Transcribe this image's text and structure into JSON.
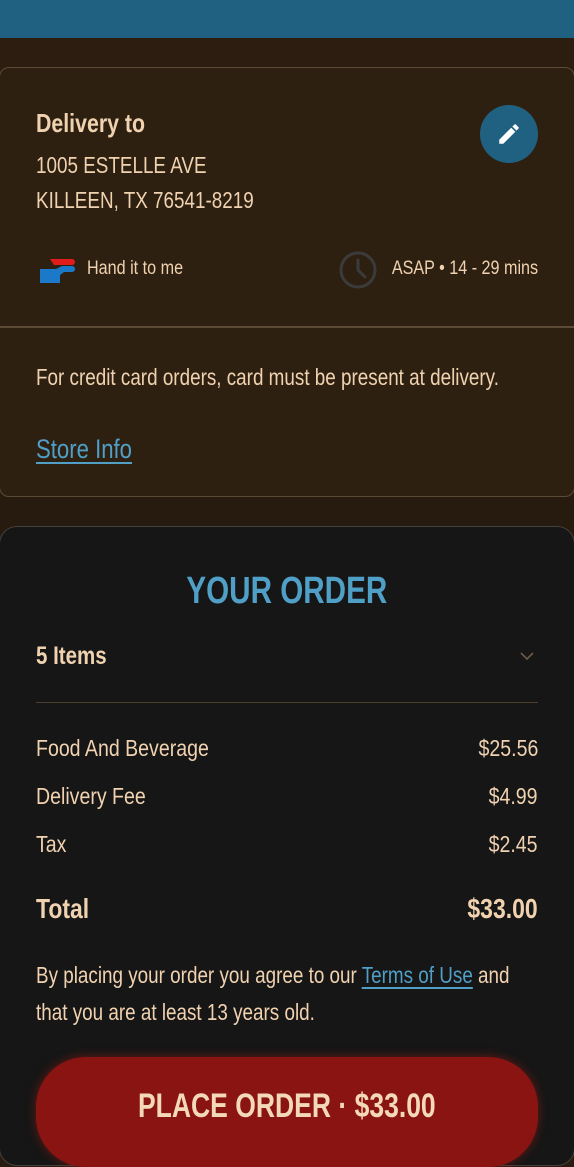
{
  "delivery": {
    "title": "Delivery to",
    "address_line1": "1005 ESTELLE AVE",
    "address_line2": "KILLEEN, TX 76541-8219",
    "handoff_option": "Hand it to me",
    "eta": "ASAP • 14 - 29 mins",
    "note": "For credit card orders, card must be present at delivery.",
    "store_info_link": "Store Info",
    "icons": [
      "edit-icon",
      "hand-icon",
      "clock-icon"
    ]
  },
  "order": {
    "heading": "YOUR ORDER",
    "items_summary": "5 Items",
    "lines": [
      {
        "label": "Food And Beverage",
        "value": "$25.56"
      },
      {
        "label": "Delivery Fee",
        "value": "$4.99"
      },
      {
        "label": "Tax",
        "value": "$2.45"
      }
    ],
    "total_label": "Total",
    "total_value": "$33.00",
    "terms_prefix": "By placing your order you agree to our",
    "terms_link": "Terms of Use",
    "terms_suffix": "and that you are at least 13 years old.",
    "place_order_label": "PLACE ORDER · $33.00"
  },
  "colors": {
    "header": "#206182",
    "accent_blue": "#4f9fc6",
    "button_red": "#8a1411",
    "text_tan": "#f0d2b0"
  }
}
